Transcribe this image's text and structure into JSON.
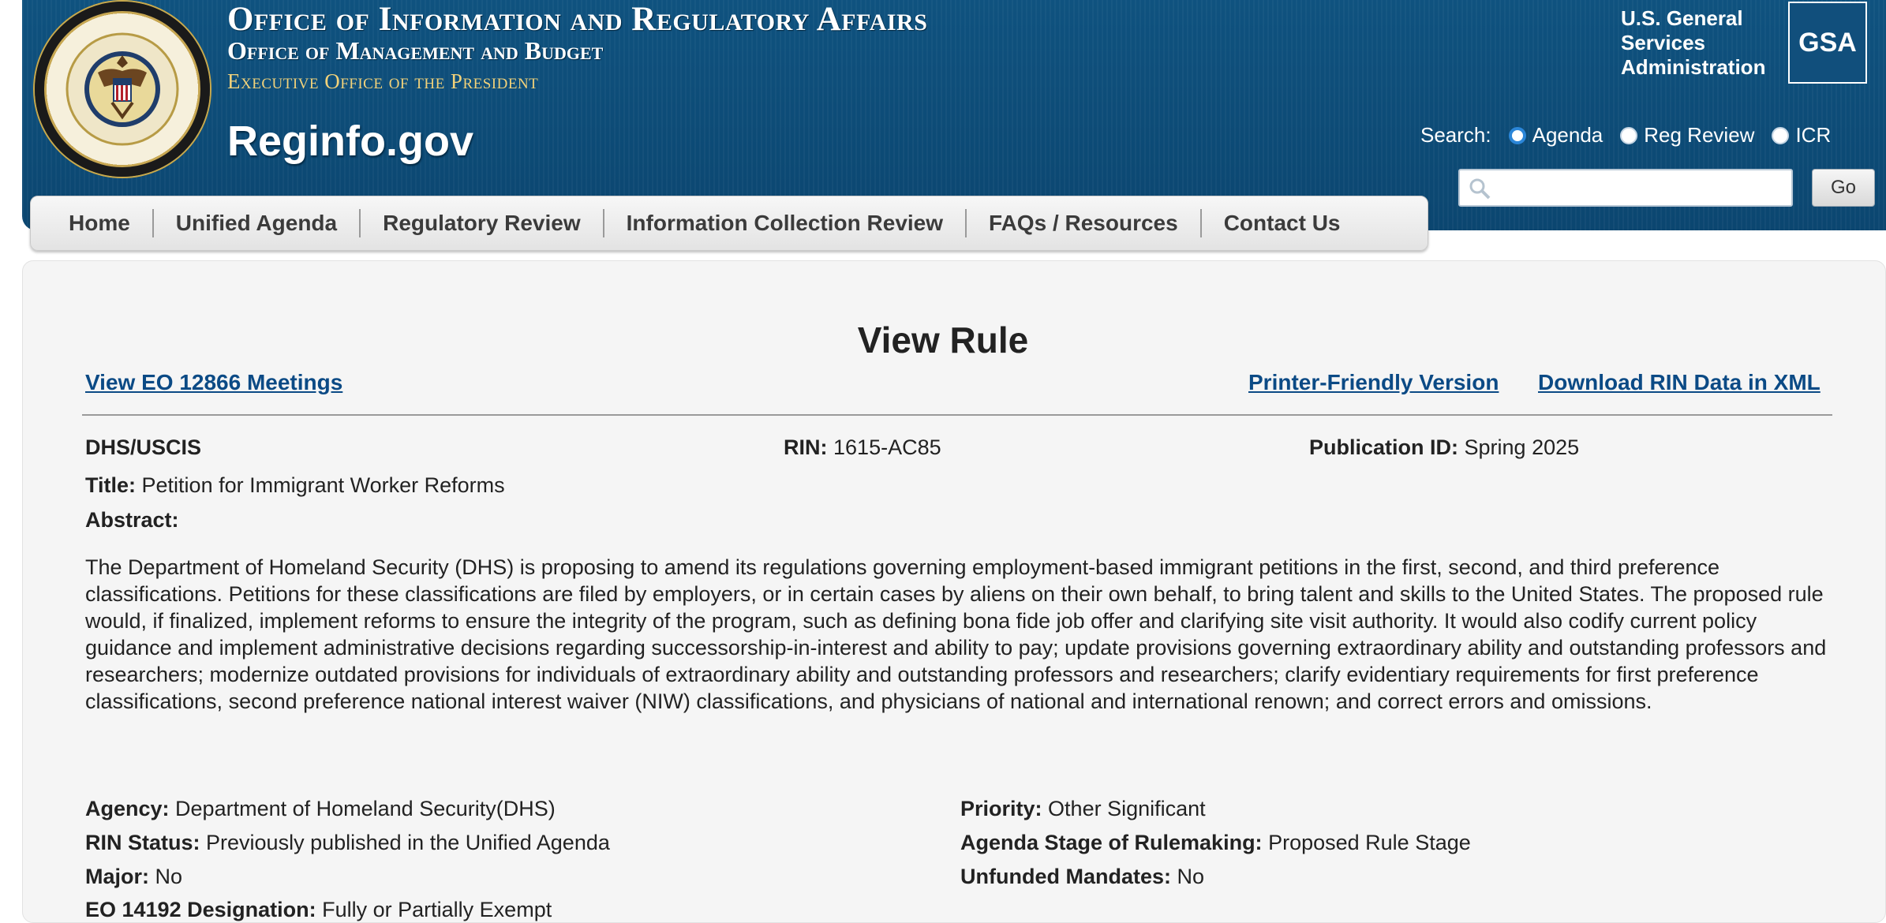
{
  "header": {
    "title_line1": "Office of Information and Regulatory Affairs",
    "title_line2": "Office of Management and Budget",
    "title_line3": "Executive Office of the President",
    "site_name": "Reginfo.gov",
    "gsa_text_line1": "U.S. General",
    "gsa_text_line2": "Services",
    "gsa_text_line3": "Administration",
    "gsa_logo": "GSA",
    "search": {
      "label": "Search:",
      "options": [
        "Agenda",
        "Reg Review",
        "ICR"
      ],
      "selected": "Agenda",
      "input_value": "",
      "go_label": "Go"
    }
  },
  "nav": {
    "items": [
      "Home",
      "Unified Agenda",
      "Regulatory Review",
      "Information Collection Review",
      "FAQs / Resources",
      "Contact Us"
    ]
  },
  "page": {
    "title": "View Rule",
    "link_meetings": "View EO 12866 Meetings",
    "link_printer": "Printer-Friendly Version",
    "link_xml": "Download RIN Data in XML"
  },
  "rule": {
    "agency_short": "DHS/USCIS",
    "rin_label": "RIN:",
    "rin_value": "1615-AC85",
    "pubid_label": "Publication ID:",
    "pubid_value": "Spring 2025",
    "title_label": "Title:",
    "title_value": "Petition for Immigrant Worker Reforms",
    "abstract_label": "Abstract:",
    "abstract_text": "The Department of Homeland Security (DHS) is proposing to amend its regulations governing employment-based immigrant petitions in the first, second, and third preference classifications. Petitions for these classifications are filed by employers, or in certain cases by aliens on their own behalf, to bring talent and skills to the United States. The proposed rule would, if finalized, implement reforms to ensure the integrity of the program, such as defining bona fide job offer and clarifying site visit authority. It would also codify current policy guidance and implement administrative decisions regarding successorship-in-interest and ability to pay; update provisions governing extraordinary ability and outstanding professors and researchers; modernize outdated provisions for individuals of extraordinary ability and outstanding professors and researchers; clarify evidentiary requirements for first preference classifications, second preference national interest waiver (NIW) classifications, and physicians of national and international renown; and correct errors and omissions.",
    "agency_label": "Agency:",
    "agency_value": "Department of Homeland Security(DHS)",
    "priority_label": "Priority:",
    "priority_value": "Other Significant",
    "rin_status_label": "RIN Status:",
    "rin_status_value": "Previously published in the Unified Agenda",
    "agenda_stage_label": "Agenda Stage of Rulemaking:",
    "agenda_stage_value": "Proposed Rule Stage",
    "major_label": "Major:",
    "major_value": "No",
    "unfunded_label": "Unfunded Mandates:",
    "unfunded_value": "No",
    "eo_label": "EO 14192 Designation:",
    "eo_value": "Fully or Partially Exempt"
  },
  "colors": {
    "banner": "#0f4d78",
    "link": "#0b4a85",
    "seal_gold": "#caa94a"
  },
  "icons": {
    "seal": "omb-eop-seal",
    "search": "magnifier-icon"
  }
}
